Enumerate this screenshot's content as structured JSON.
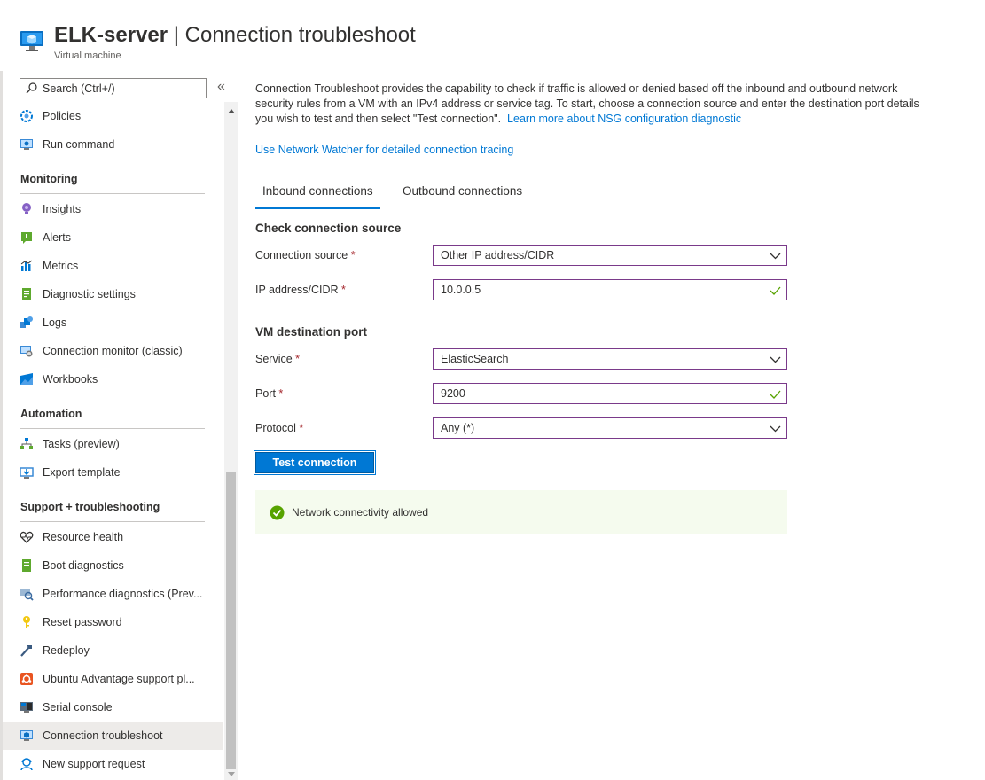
{
  "header": {
    "resource_name": "ELK-server",
    "separator": " | ",
    "page_name": "Connection troubleshoot",
    "subtitle": "Virtual machine"
  },
  "sidebar": {
    "search_placeholder": "Search (Ctrl+/)",
    "collapse_glyph": "«",
    "items_top": [
      {
        "label": "Policies",
        "icon": "policies-icon"
      },
      {
        "label": "Run command",
        "icon": "run-command-icon"
      }
    ],
    "groups": [
      {
        "title": "Monitoring",
        "items": [
          {
            "label": "Insights",
            "icon": "insights-icon"
          },
          {
            "label": "Alerts",
            "icon": "alerts-icon"
          },
          {
            "label": "Metrics",
            "icon": "metrics-icon"
          },
          {
            "label": "Diagnostic settings",
            "icon": "diagnostic-settings-icon"
          },
          {
            "label": "Logs",
            "icon": "logs-icon"
          },
          {
            "label": "Connection monitor (classic)",
            "icon": "connection-monitor-icon"
          },
          {
            "label": "Workbooks",
            "icon": "workbooks-icon"
          }
        ]
      },
      {
        "title": "Automation",
        "items": [
          {
            "label": "Tasks (preview)",
            "icon": "tasks-icon"
          },
          {
            "label": "Export template",
            "icon": "export-template-icon"
          }
        ]
      },
      {
        "title": "Support + troubleshooting",
        "items": [
          {
            "label": "Resource health",
            "icon": "heart-icon"
          },
          {
            "label": "Boot diagnostics",
            "icon": "boot-diagnostics-icon"
          },
          {
            "label": "Performance diagnostics (Prev...",
            "icon": "performance-diagnostics-icon"
          },
          {
            "label": "Reset password",
            "icon": "key-icon"
          },
          {
            "label": "Redeploy",
            "icon": "hammer-icon"
          },
          {
            "label": "Ubuntu Advantage support pl...",
            "icon": "ubuntu-icon"
          },
          {
            "label": "Serial console",
            "icon": "serial-console-icon"
          },
          {
            "label": "Connection troubleshoot",
            "icon": "connection-troubleshoot-icon",
            "active": true
          },
          {
            "label": "New support request",
            "icon": "support-person-icon"
          }
        ]
      }
    ]
  },
  "main": {
    "description": "Connection Troubleshoot provides the capability to check if traffic is allowed or denied based off the inbound and outbound network security rules from a VM with an IPv4 address or service tag. To start, choose a connection source and enter the destination port details you wish to test and then select \"Test connection\".",
    "learn_more_link": "Learn more about NSG configuration diagnostic",
    "network_watcher_link": "Use Network Watcher for detailed connection tracing",
    "tabs": [
      {
        "label": "Inbound connections",
        "active": true
      },
      {
        "label": "Outbound connections",
        "active": false
      }
    ],
    "source_section_title": "Check connection source",
    "connection_source": {
      "label": "Connection source",
      "required_mark": "*",
      "value": "Other IP address/CIDR"
    },
    "ip_address": {
      "label": "IP address/CIDR",
      "required_mark": "*",
      "value": "10.0.0.5"
    },
    "destination_section_title": "VM destination port",
    "service": {
      "label": "Service",
      "required_mark": "*",
      "value": "ElasticSearch"
    },
    "port": {
      "label": "Port",
      "required_mark": "*",
      "value": "9200"
    },
    "protocol": {
      "label": "Protocol",
      "required_mark": "*",
      "value": "Any (*)"
    },
    "test_button_label": "Test connection",
    "result_message": "Network connectivity allowed"
  },
  "colors": {
    "accent": "#0078d4",
    "success": "#57a300",
    "required": "#a4262c",
    "field_border": "#7a3a8a",
    "result_background": "#f5fbee",
    "active_nav_background": "#edebe9"
  }
}
